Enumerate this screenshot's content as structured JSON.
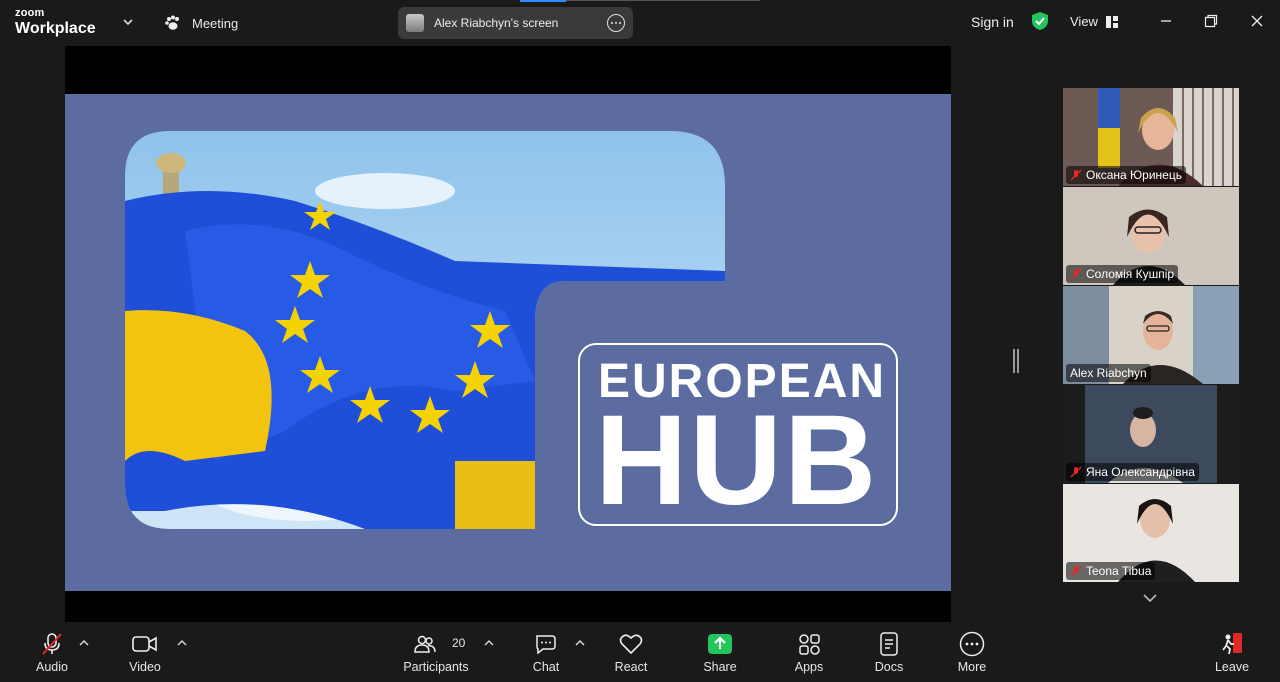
{
  "app": {
    "brand_top": "zoom",
    "brand_bottom": "Workplace"
  },
  "header": {
    "meeting_label": "Meeting",
    "screen_share_label": "Alex Riabchyn's screen",
    "sign_in": "Sign in",
    "view_label": "View"
  },
  "slide": {
    "title_line1": "EUROPEAN",
    "title_line2": "HUB"
  },
  "gallery": {
    "participants": [
      {
        "name": "Оксана Юринець",
        "muted": true,
        "active": false
      },
      {
        "name": "Соломія Кушпір",
        "muted": true,
        "active": false
      },
      {
        "name": "Alex Riabchyn",
        "muted": false,
        "active": true
      },
      {
        "name": "Яна Олександрівна",
        "muted": true,
        "active": false
      },
      {
        "name": "Teona Tibua",
        "muted": true,
        "active": false
      }
    ]
  },
  "toolbar": {
    "audio": "Audio",
    "video": "Video",
    "participants": "Participants",
    "participants_count": "20",
    "chat": "Chat",
    "react": "React",
    "share": "Share",
    "apps": "Apps",
    "docs": "Docs",
    "more": "More",
    "leave": "Leave"
  },
  "colors": {
    "background": "#1a1a1a",
    "slide_bg": "#5c6ba0",
    "active_speaker": "#22c55e",
    "share_green": "#22c55e",
    "leave_red": "#e02828",
    "accent_blue": "#2d8cff"
  }
}
